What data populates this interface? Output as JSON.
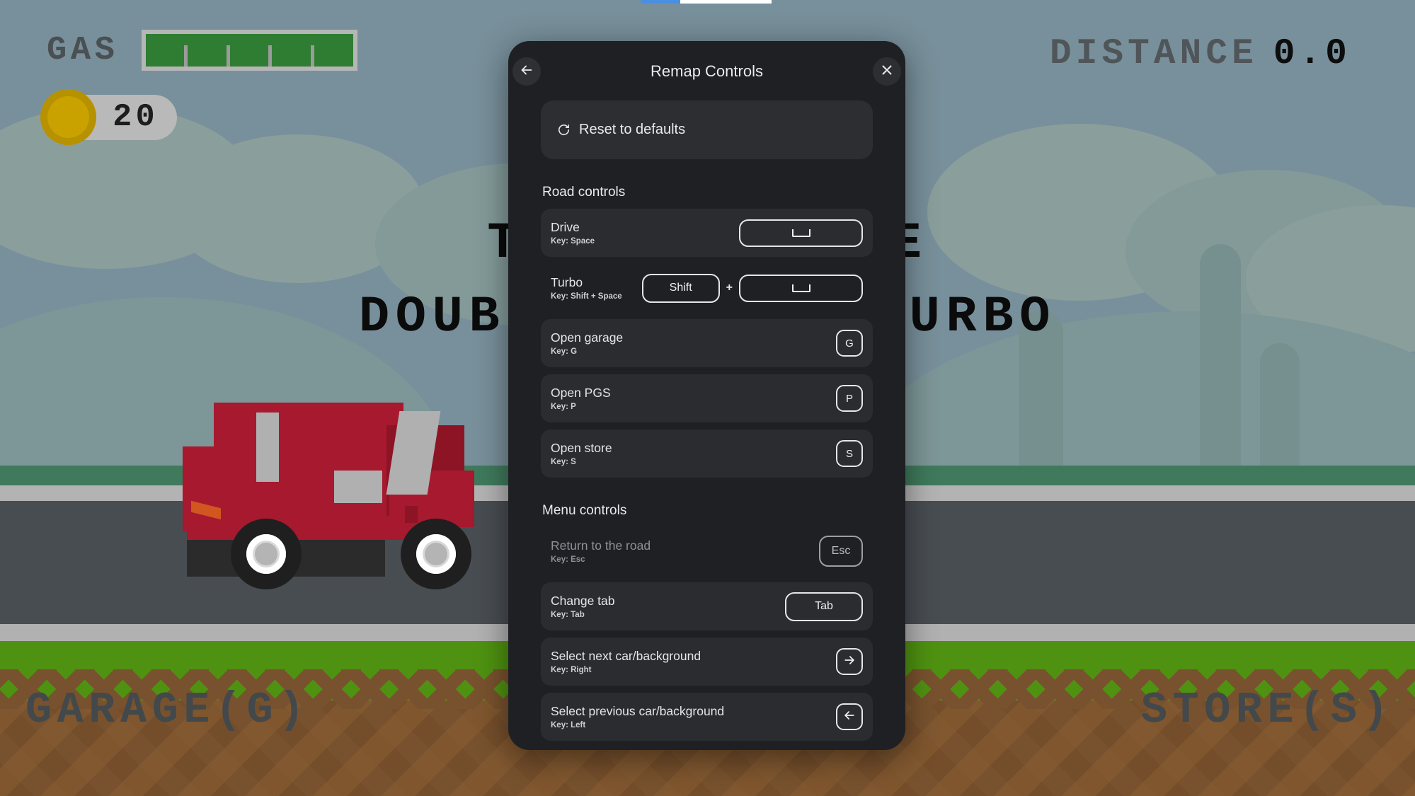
{
  "game": {
    "gas": {
      "label": "GAS",
      "fill_percent": 100,
      "tick_count": 4
    },
    "coins": {
      "value": "20",
      "icon": "coin-icon"
    },
    "distance": {
      "label": "DISTANCE",
      "value": "0.0"
    },
    "hint_line1": "TAP TO DRIVE",
    "hint_line2": "DOUBLE TAP TO TURBO",
    "garage_button": "GARAGE(G)",
    "store_button": "STORE(S)",
    "colors": {
      "sky": "#78909b",
      "road": "#484d52",
      "grass": "#4f9211",
      "dirt": "#78522e",
      "gas_fill": "#2f7d32",
      "coin": "#c9a200",
      "car_body": "#a6192e"
    }
  },
  "top_progress": {
    "percent": 30,
    "accent": "#4a90e2"
  },
  "dialog": {
    "title": "Remap Controls",
    "back_icon": "arrow-left-icon",
    "close_icon": "close-icon",
    "reset": {
      "label": "Reset to defaults",
      "icon": "reset-icon"
    },
    "sections": [
      {
        "title": "Road controls",
        "rows": [
          {
            "name": "Drive",
            "key_label": "Key: Space",
            "state": "filled",
            "keys": [
              {
                "type": "wide",
                "glyph": "space-icon"
              }
            ]
          },
          {
            "name": "Turbo",
            "key_label": "Key: Shift + Space",
            "state": "plain",
            "keys": [
              {
                "type": "med",
                "text": "Shift"
              },
              {
                "type": "plus",
                "text": "+"
              },
              {
                "type": "wide",
                "glyph": "space-icon"
              }
            ]
          },
          {
            "name": "Open garage",
            "key_label": "Key: G",
            "state": "filled",
            "keys": [
              {
                "type": "sq",
                "text": "G"
              }
            ]
          },
          {
            "name": "Open PGS",
            "key_label": "Key: P",
            "state": "filled",
            "keys": [
              {
                "type": "sq",
                "text": "P"
              }
            ]
          },
          {
            "name": "Open store",
            "key_label": "Key: S",
            "state": "filled",
            "keys": [
              {
                "type": "sq",
                "text": "S"
              }
            ]
          }
        ]
      },
      {
        "title": "Menu controls",
        "rows": [
          {
            "name": "Return to the road",
            "key_label": "Key: Esc",
            "state": "dim",
            "keys": [
              {
                "type": "med-sm",
                "text": "Esc"
              }
            ]
          },
          {
            "name": "Change tab",
            "key_label": "Key: Tab",
            "state": "filled",
            "keys": [
              {
                "type": "med",
                "text": "Tab"
              }
            ]
          },
          {
            "name": "Select next car/background",
            "key_label": "Key: Right",
            "state": "filled",
            "keys": [
              {
                "type": "sq",
                "glyph": "arrow-right-icon"
              }
            ]
          },
          {
            "name": "Select previous car/background",
            "key_label": "Key: Left",
            "state": "filled",
            "keys": [
              {
                "type": "sq",
                "glyph": "arrow-left-icon"
              }
            ]
          }
        ]
      }
    ]
  }
}
